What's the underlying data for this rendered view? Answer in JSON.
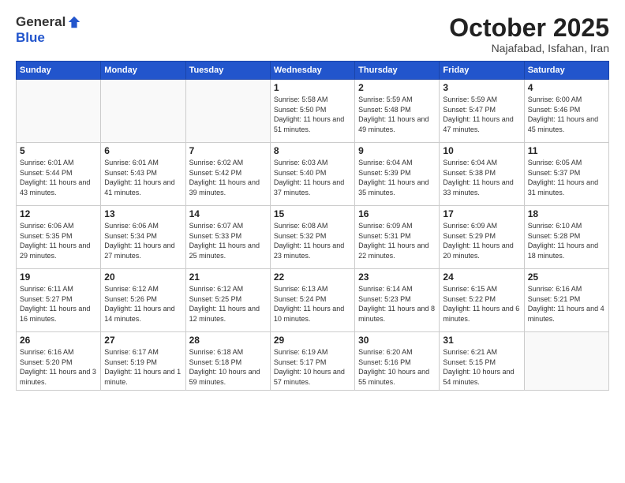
{
  "logo": {
    "general": "General",
    "blue": "Blue"
  },
  "title": "October 2025",
  "subtitle": "Najafabad, Isfahan, Iran",
  "days_of_week": [
    "Sunday",
    "Monday",
    "Tuesday",
    "Wednesday",
    "Thursday",
    "Friday",
    "Saturday"
  ],
  "weeks": [
    [
      {
        "day": "",
        "info": ""
      },
      {
        "day": "",
        "info": ""
      },
      {
        "day": "",
        "info": ""
      },
      {
        "day": "1",
        "info": "Sunrise: 5:58 AM\nSunset: 5:50 PM\nDaylight: 11 hours\nand 51 minutes."
      },
      {
        "day": "2",
        "info": "Sunrise: 5:59 AM\nSunset: 5:48 PM\nDaylight: 11 hours\nand 49 minutes."
      },
      {
        "day": "3",
        "info": "Sunrise: 5:59 AM\nSunset: 5:47 PM\nDaylight: 11 hours\nand 47 minutes."
      },
      {
        "day": "4",
        "info": "Sunrise: 6:00 AM\nSunset: 5:46 PM\nDaylight: 11 hours\nand 45 minutes."
      }
    ],
    [
      {
        "day": "5",
        "info": "Sunrise: 6:01 AM\nSunset: 5:44 PM\nDaylight: 11 hours\nand 43 minutes."
      },
      {
        "day": "6",
        "info": "Sunrise: 6:01 AM\nSunset: 5:43 PM\nDaylight: 11 hours\nand 41 minutes."
      },
      {
        "day": "7",
        "info": "Sunrise: 6:02 AM\nSunset: 5:42 PM\nDaylight: 11 hours\nand 39 minutes."
      },
      {
        "day": "8",
        "info": "Sunrise: 6:03 AM\nSunset: 5:40 PM\nDaylight: 11 hours\nand 37 minutes."
      },
      {
        "day": "9",
        "info": "Sunrise: 6:04 AM\nSunset: 5:39 PM\nDaylight: 11 hours\nand 35 minutes."
      },
      {
        "day": "10",
        "info": "Sunrise: 6:04 AM\nSunset: 5:38 PM\nDaylight: 11 hours\nand 33 minutes."
      },
      {
        "day": "11",
        "info": "Sunrise: 6:05 AM\nSunset: 5:37 PM\nDaylight: 11 hours\nand 31 minutes."
      }
    ],
    [
      {
        "day": "12",
        "info": "Sunrise: 6:06 AM\nSunset: 5:35 PM\nDaylight: 11 hours\nand 29 minutes."
      },
      {
        "day": "13",
        "info": "Sunrise: 6:06 AM\nSunset: 5:34 PM\nDaylight: 11 hours\nand 27 minutes."
      },
      {
        "day": "14",
        "info": "Sunrise: 6:07 AM\nSunset: 5:33 PM\nDaylight: 11 hours\nand 25 minutes."
      },
      {
        "day": "15",
        "info": "Sunrise: 6:08 AM\nSunset: 5:32 PM\nDaylight: 11 hours\nand 23 minutes."
      },
      {
        "day": "16",
        "info": "Sunrise: 6:09 AM\nSunset: 5:31 PM\nDaylight: 11 hours\nand 22 minutes."
      },
      {
        "day": "17",
        "info": "Sunrise: 6:09 AM\nSunset: 5:29 PM\nDaylight: 11 hours\nand 20 minutes."
      },
      {
        "day": "18",
        "info": "Sunrise: 6:10 AM\nSunset: 5:28 PM\nDaylight: 11 hours\nand 18 minutes."
      }
    ],
    [
      {
        "day": "19",
        "info": "Sunrise: 6:11 AM\nSunset: 5:27 PM\nDaylight: 11 hours\nand 16 minutes."
      },
      {
        "day": "20",
        "info": "Sunrise: 6:12 AM\nSunset: 5:26 PM\nDaylight: 11 hours\nand 14 minutes."
      },
      {
        "day": "21",
        "info": "Sunrise: 6:12 AM\nSunset: 5:25 PM\nDaylight: 11 hours\nand 12 minutes."
      },
      {
        "day": "22",
        "info": "Sunrise: 6:13 AM\nSunset: 5:24 PM\nDaylight: 11 hours\nand 10 minutes."
      },
      {
        "day": "23",
        "info": "Sunrise: 6:14 AM\nSunset: 5:23 PM\nDaylight: 11 hours\nand 8 minutes."
      },
      {
        "day": "24",
        "info": "Sunrise: 6:15 AM\nSunset: 5:22 PM\nDaylight: 11 hours\nand 6 minutes."
      },
      {
        "day": "25",
        "info": "Sunrise: 6:16 AM\nSunset: 5:21 PM\nDaylight: 11 hours\nand 4 minutes."
      }
    ],
    [
      {
        "day": "26",
        "info": "Sunrise: 6:16 AM\nSunset: 5:20 PM\nDaylight: 11 hours\nand 3 minutes."
      },
      {
        "day": "27",
        "info": "Sunrise: 6:17 AM\nSunset: 5:19 PM\nDaylight: 11 hours\nand 1 minute."
      },
      {
        "day": "28",
        "info": "Sunrise: 6:18 AM\nSunset: 5:18 PM\nDaylight: 10 hours\nand 59 minutes."
      },
      {
        "day": "29",
        "info": "Sunrise: 6:19 AM\nSunset: 5:17 PM\nDaylight: 10 hours\nand 57 minutes."
      },
      {
        "day": "30",
        "info": "Sunrise: 6:20 AM\nSunset: 5:16 PM\nDaylight: 10 hours\nand 55 minutes."
      },
      {
        "day": "31",
        "info": "Sunrise: 6:21 AM\nSunset: 5:15 PM\nDaylight: 10 hours\nand 54 minutes."
      },
      {
        "day": "",
        "info": ""
      }
    ]
  ]
}
